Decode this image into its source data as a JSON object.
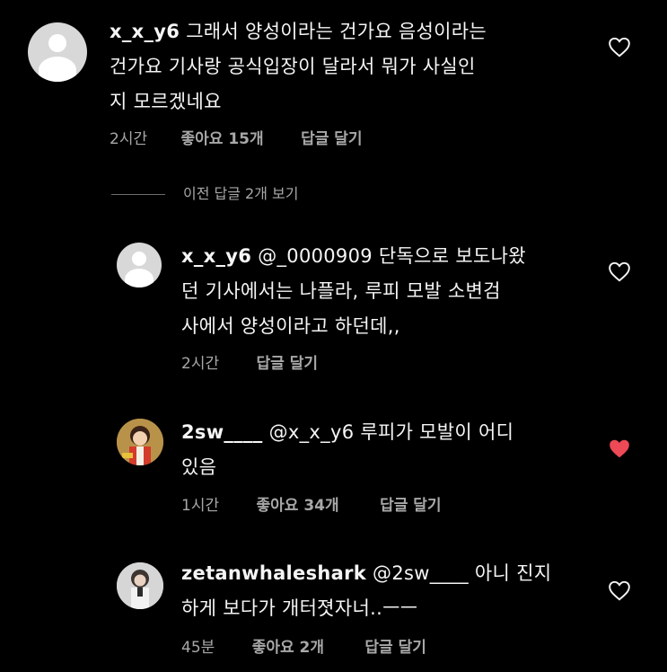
{
  "colors": {
    "background": "#000000",
    "text": "#f5f5f5",
    "meta": "#a8a8a8",
    "liked_heart": "#ed4956"
  },
  "comments": [
    {
      "username": "x_x_y6",
      "mention": "",
      "lines": [
        "그래서 양성이라는 건가요 음성이라는",
        "건가요 기사랑 공식입장이 달라서 뭐가 사실인",
        "지 모르겠네요"
      ],
      "time": "2시간",
      "likes": "좋아요 15개",
      "reply": "답글 달기",
      "avatar": "default-profile-icon",
      "liked": false
    }
  ],
  "view_previous_replies": "이전 답글 2개 보기",
  "replies": [
    {
      "username": "x_x_y6",
      "mention": "@_0000909",
      "lines": [
        "단독으로 보도나왔",
        "던 기사에서는 나플라, 루피 모발 소변검",
        "사에서 양성이라고 하던데,,"
      ],
      "time": "2시간",
      "likes": "",
      "reply": "답글 달기",
      "avatar": "default-profile-icon",
      "liked": false
    },
    {
      "username": "2sw____",
      "mention": "@x_x_y6",
      "lines": [
        "루피가 모발이 어디",
        "있음"
      ],
      "time": "1시간",
      "likes": "좋아요 34개",
      "reply": "답글 달기",
      "avatar": "cartoon-profile-photo",
      "liked": true
    },
    {
      "username": "zetanwhaleshark",
      "mention": "@2sw____",
      "lines": [
        "아니 진지",
        "하게 보다가 개터졋자너..ㅡㅡ"
      ],
      "time": "45분",
      "likes": "좋아요 2개",
      "reply": "답글 달기",
      "avatar": "person-profile-photo",
      "liked": false
    }
  ]
}
